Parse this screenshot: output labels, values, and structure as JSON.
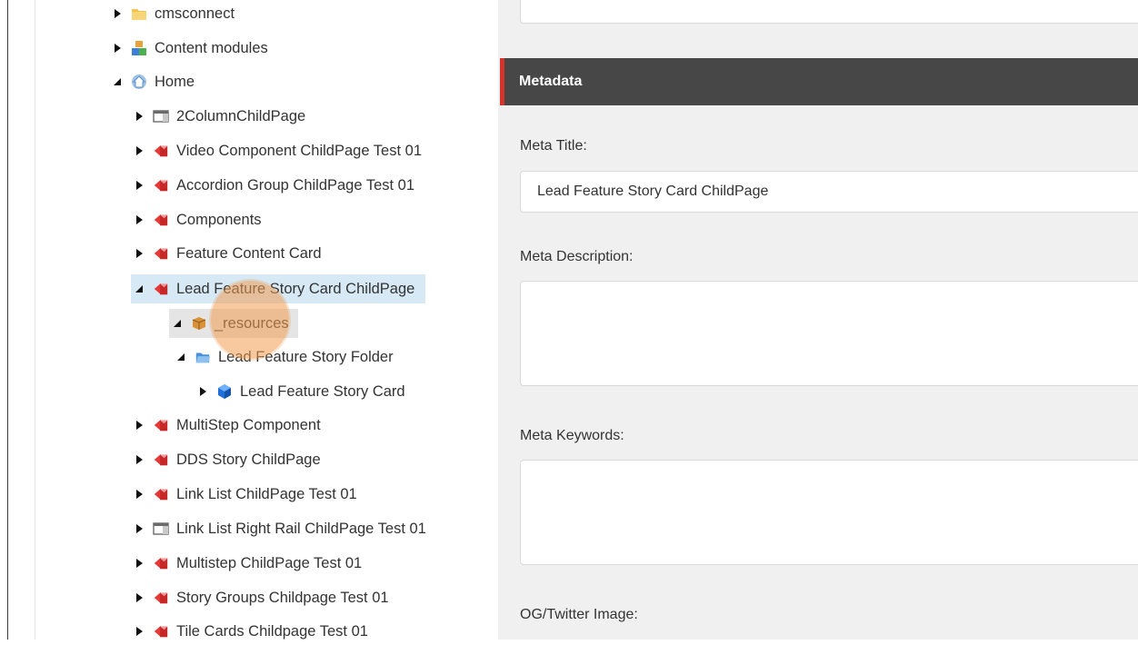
{
  "tree": {
    "nodes": [
      {
        "label": "cmsconnect",
        "icon": "folder-icon",
        "state": "collapsed"
      },
      {
        "label": "Content modules",
        "icon": "module-icon",
        "state": "collapsed"
      },
      {
        "label": "Home",
        "icon": "home-icon",
        "state": "expanded"
      },
      {
        "label": "2ColumnChildPage",
        "icon": "layout-page-icon",
        "state": "collapsed"
      },
      {
        "label": "Video Component ChildPage Test 01",
        "icon": "page-item-icon",
        "state": "collapsed"
      },
      {
        "label": "Accordion Group ChildPage Test 01",
        "icon": "page-item-icon",
        "state": "collapsed"
      },
      {
        "label": "Components",
        "icon": "page-item-icon",
        "state": "collapsed"
      },
      {
        "label": "Feature Content Card",
        "icon": "page-item-icon",
        "state": "collapsed"
      },
      {
        "label": "Lead Feature Story Card ChildPage",
        "icon": "page-item-icon",
        "state": "expanded",
        "selected": true
      },
      {
        "label": "_resources",
        "icon": "resources-box-icon",
        "state": "expanded",
        "hover": true
      },
      {
        "label": "Lead Feature Story Folder",
        "icon": "blue-folder-icon",
        "state": "expanded"
      },
      {
        "label": "Lead Feature Story Card",
        "icon": "blue-cube-icon",
        "state": "collapsed"
      },
      {
        "label": "MultiStep Component",
        "icon": "page-item-icon",
        "state": "collapsed"
      },
      {
        "label": "DDS Story ChildPage",
        "icon": "page-item-icon",
        "state": "collapsed"
      },
      {
        "label": "Link List ChildPage Test 01",
        "icon": "page-item-icon",
        "state": "collapsed"
      },
      {
        "label": "Link List Right Rail ChildPage Test 01",
        "icon": "layout-page-icon",
        "state": "collapsed"
      },
      {
        "label": "Multistep ChildPage Test 01",
        "icon": "page-item-icon",
        "state": "collapsed"
      },
      {
        "label": "Story Groups Childpage Test 01",
        "icon": "page-item-icon",
        "state": "collapsed"
      },
      {
        "label": "Tile Cards Childpage Test 01",
        "icon": "page-item-icon",
        "state": "collapsed"
      }
    ]
  },
  "metadata": {
    "section_title": "Metadata",
    "meta_title_label": "Meta Title:",
    "meta_title_value": "Lead Feature Story Card ChildPage",
    "meta_description_label": "Meta Description:",
    "meta_description_value": "",
    "meta_keywords_label": "Meta Keywords:",
    "meta_keywords_value": "",
    "og_image_label": "OG/Twitter Image:"
  },
  "colors": {
    "section_header_bg": "#474747",
    "section_accent": "#d7322c",
    "selected_row_bg": "#d6e9f5",
    "click_indicator": "#f39c50",
    "content_bg": "#f0f0f0"
  }
}
